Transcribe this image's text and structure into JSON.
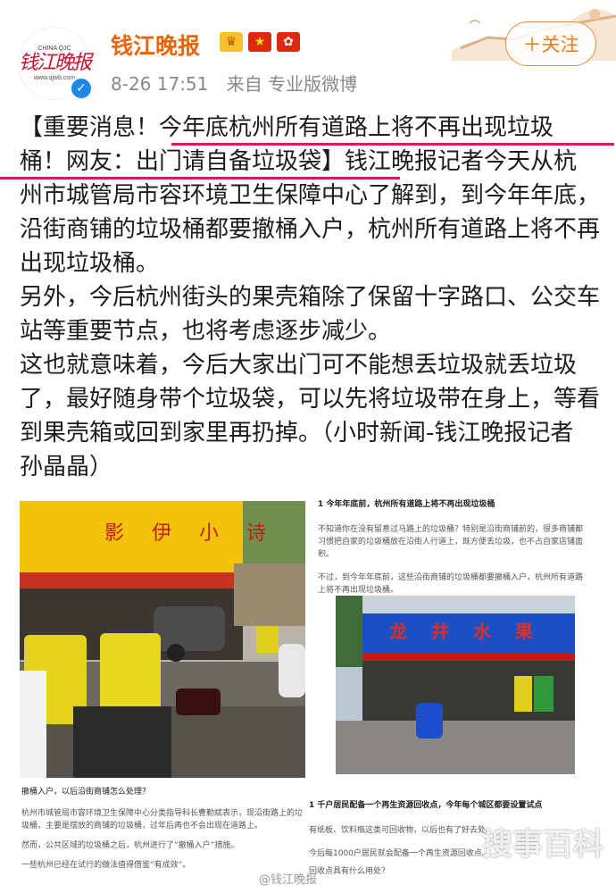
{
  "post": {
    "account_name": "钱江晚报",
    "timestamp": "8-26 17:51",
    "source": "来自 专业版微博",
    "follow_label": "＋关注",
    "avatar": {
      "brand": "CHINA QJC",
      "logo_text": "钱江晚报",
      "site": "www.qjwb.com"
    },
    "badge_icons": [
      "crown-icon",
      "china-flag-icon",
      "hong-kong-flag-icon"
    ],
    "text": {
      "p1_prefix": "【重要消息！",
      "p1_highlight": "今年底杭州所有道路上将不再出现垃圾桶！网友：出门请自备垃圾袋",
      "p1_suffix": "】钱江晚报记者今天从杭州市城管局市容环境卫生保障中心了解到，到今年年底，沿街商铺的垃圾桶都要撤桶入户，杭州所有道路上将不再出现垃圾桶。",
      "p2": "另外，今后杭州街头的果壳箱除了保留十字路口、公交车站等重要节点，也将考虑逐步减少。",
      "p3": "这也就意味着，今后大家出门可不能想丢垃圾就丢垃圾了，最好随身带个垃圾袋，可以先将垃圾带在身上，等看到果壳箱或回到家里再扔掉。（小时新闻-钱江晚报记者 孙晶晶）"
    },
    "highlight_color": "#d81b60"
  },
  "images": {
    "left_sign": "影 伊 小 诗",
    "left_caption_title": "撤桶入户，以后沿街商铺怎么处理？",
    "left_caption_body": "杭州市城管局市容环境卫生保障中心分类指导科长曹勤斌表示，现沿街路上的垃圾桶，主要是摆放的商铺的垃圾桶，过年后再也不会出现在道路上。",
    "left_caption_more": "然而，公共区域的垃圾桶之后，杭州进行了“撤桶入户”措施。",
    "left_caption_end": "一些杭州已经在试行的做法值得借鉴“有成效”。",
    "right_top_title": "1 今年年底前，杭州所有道路上将不再出现垃圾桶",
    "right_top_body": "不知道你在没有留意过马路上的垃圾桶？特别是沿街商铺前的，很多商铺都习惯把自家的垃圾桶放在沿街人行道上，既方便丢垃圾，也不占自家店铺面积。",
    "right_top_body2": "不过，到今年年底前，这些沿街商铺的垃圾桶都要撤桶入户，杭州所有道路上将不再出现垃圾桶。",
    "right_sign": "龙 井 水 果",
    "right_bottom_title": "1 千户居民配备一个再生资源回收点，今年每个城区都要设置试点",
    "right_bottom_body": "有纸板、饮料瓶这类可回收物，以后也有了好去处。",
    "right_bottom_body2": "今后每1000户居民就会配备一个再生资源回收点。",
    "right_bottom_q": "回收点具有什么用处？",
    "watermark_big": "搜事百科",
    "watermark_small": "@钱江晚报"
  }
}
